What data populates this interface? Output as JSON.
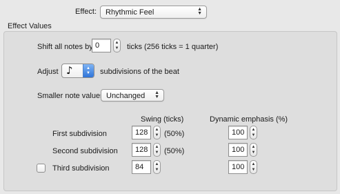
{
  "effect": {
    "label": "Effect:",
    "selected": "Rhythmic Feel"
  },
  "group": {
    "title": "Effect Values"
  },
  "shift": {
    "label": "Shift all notes by",
    "value": "0",
    "suffix": "ticks (256 ticks = 1 quarter)"
  },
  "adjust": {
    "label": "Adjust",
    "note_symbol": "♪",
    "suffix": "subdivisions of the beat"
  },
  "smaller": {
    "label": "Smaller note values:",
    "selected": "Unchanged"
  },
  "columns": {
    "swing": "Swing (ticks)",
    "emphasis": "Dynamic emphasis (%)"
  },
  "rows": [
    {
      "label": "First subdivision",
      "swing": "128",
      "percent": "(50%)",
      "emphasis": "100"
    },
    {
      "label": "Second subdivision",
      "swing": "128",
      "percent": "(50%)",
      "emphasis": "100"
    },
    {
      "label": "Third subdivision",
      "swing": "84",
      "percent": "",
      "emphasis": "100",
      "checked": false
    }
  ],
  "icons": {
    "popup_arrows": "up-down-arrows-icon",
    "stepper": "stepper-arrows-icon",
    "note": "eighth-note-icon"
  }
}
